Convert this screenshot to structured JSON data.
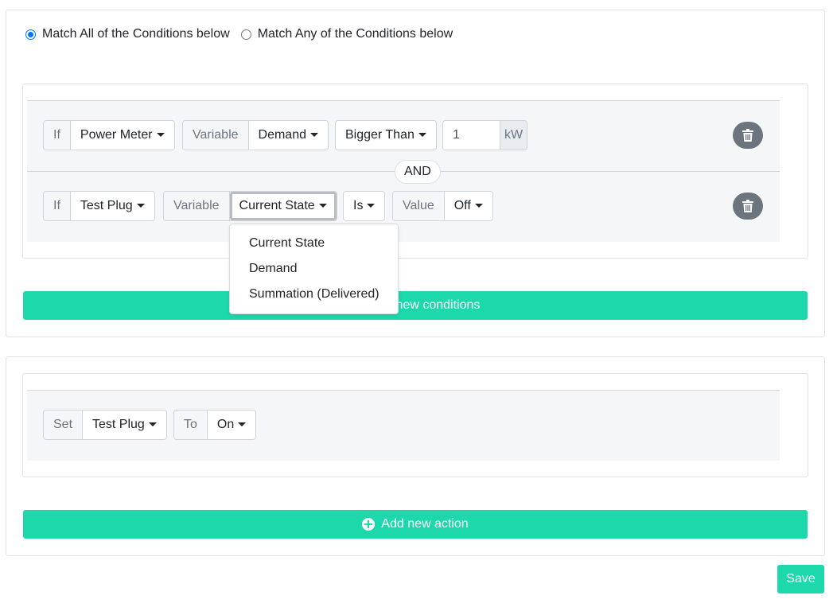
{
  "match": {
    "all_label": "Match All of the Conditions below",
    "any_label": "Match Any of the Conditions below",
    "selected": "all"
  },
  "conditions": [
    {
      "if_label": "If",
      "device": "Power Meter",
      "variable_label": "Variable",
      "variable": "Demand",
      "operator": "Bigger Than",
      "value": "1",
      "unit": "kW"
    },
    {
      "if_label": "If",
      "device": "Test Plug",
      "variable_label": "Variable",
      "variable": "Current State",
      "operator": "Is",
      "value_label": "Value",
      "value": "Off"
    }
  ],
  "connector": "AND",
  "variable_dropdown": {
    "open": true,
    "options": [
      "Current State",
      "Demand",
      "Summation (Delivered)"
    ]
  },
  "add_condition_label": "Add new conditions",
  "actions": [
    {
      "set_label": "Set",
      "device": "Test Plug",
      "to_label": "To",
      "state": "On"
    }
  ],
  "add_action_label": "Add new action",
  "save_label": "Save",
  "colors": {
    "accent": "#1dd8ab",
    "trash_button": "#6c757d",
    "radio_selected": "#0075ff"
  },
  "icons": {
    "delete": "trash-icon",
    "add": "plus-circle-icon"
  }
}
